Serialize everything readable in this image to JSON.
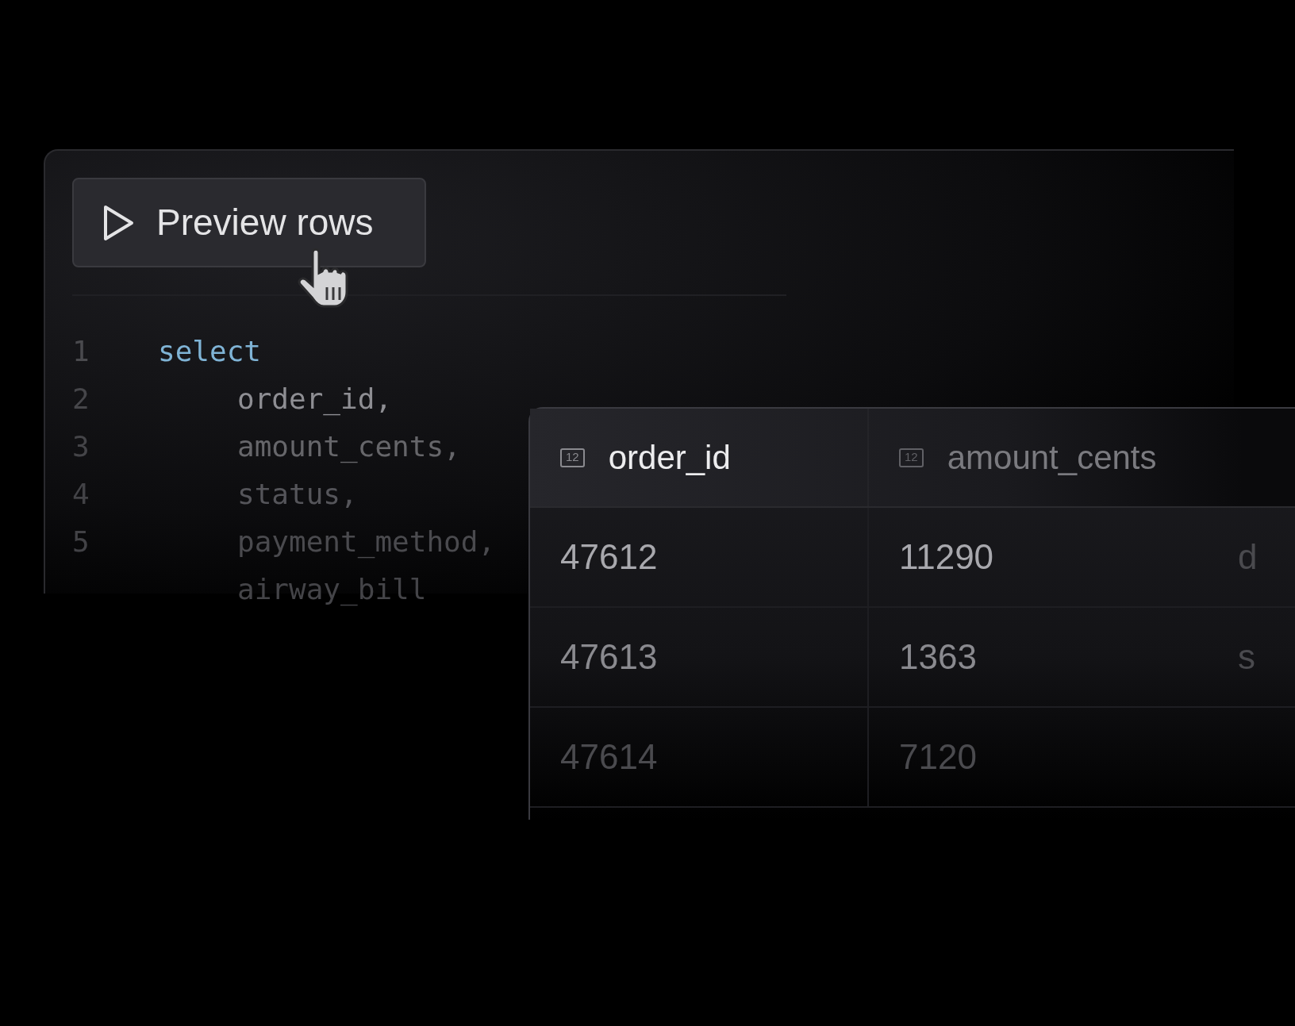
{
  "editor": {
    "run_button": {
      "label": "Preview rows"
    },
    "lines": [
      {
        "number": "1",
        "text": "select",
        "kind": "keyword"
      },
      {
        "number": "2",
        "text": "order_id,",
        "kind": "column"
      },
      {
        "number": "3",
        "text": "amount_cents,",
        "kind": "column"
      },
      {
        "number": "4",
        "text": "status,",
        "kind": "column"
      },
      {
        "number": "5",
        "text": "payment_method,",
        "kind": "column"
      },
      {
        "text": "airway_bill",
        "kind": "column"
      }
    ]
  },
  "results": {
    "columns": [
      {
        "type_badge": "12",
        "name": "order_id"
      },
      {
        "type_badge": "12",
        "name": "amount_cents"
      }
    ],
    "rows": [
      {
        "cells": [
          "47612",
          "11290",
          "d"
        ]
      },
      {
        "cells": [
          "47613",
          "1363",
          "s"
        ]
      },
      {
        "cells": [
          "47614",
          "7120"
        ]
      }
    ]
  }
}
